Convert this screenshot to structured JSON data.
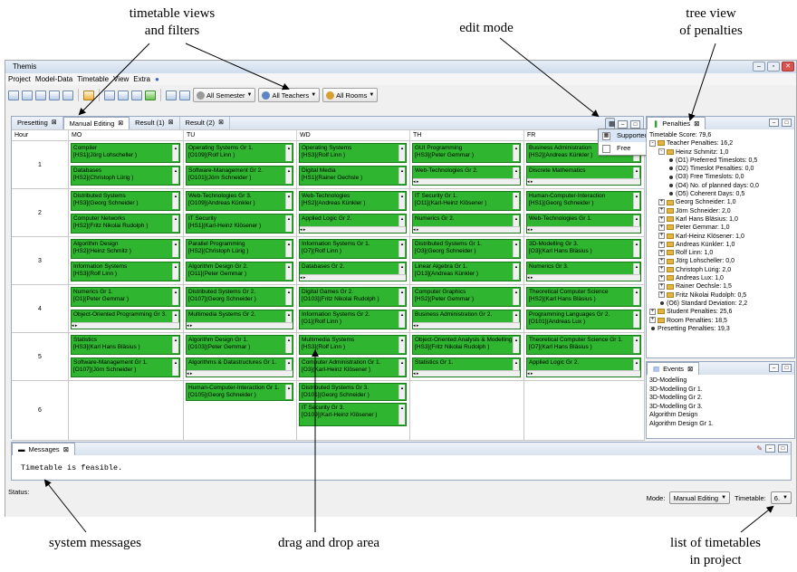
{
  "annotations": {
    "timetable_views": [
      "timetable views",
      "and filters"
    ],
    "edit_mode": "edit mode",
    "tree_view": [
      "tree view",
      "of penalties"
    ],
    "system_messages": "system messages",
    "drag_drop": "drag and drop area",
    "list_timetables": [
      "list of timetables",
      "in project"
    ]
  },
  "window": {
    "title": "Themis"
  },
  "menu": [
    "Project",
    "Model-Data",
    "Timetable",
    "View",
    "Extra"
  ],
  "filters": {
    "semester": "All Semester",
    "teachers": "All Teachers",
    "rooms": "All Rooms"
  },
  "editor_tabs": [
    {
      "label": "Presetting"
    },
    {
      "label": "Manual Editing"
    },
    {
      "label": "Result (1)"
    },
    {
      "label": "Result (2)"
    }
  ],
  "grid": {
    "hour_label": "Hour",
    "days": [
      "MO",
      "TU",
      "WD",
      "TH",
      "FR"
    ],
    "hours": [
      "1",
      "2",
      "3",
      "4",
      "5",
      "6"
    ]
  },
  "edit_mode_menu": {
    "options": [
      "Supported",
      "Free"
    ],
    "selected": "Supported"
  },
  "events": [
    [
      "Compiler",
      "[HS1](Jörg Lohscheller )",
      "Databases",
      "[HS2](Christoph Lürig )"
    ],
    [
      "Operating Systems Gr 1.",
      "[O109](Rolf Linn )",
      "Software-Management Gr 2.",
      "[O101](Jörn Schneider )"
    ],
    [
      "Operating Systems",
      "[HS3](Rolf Linn )",
      "Digital Media",
      "[HS1](Rainer Oechsle )"
    ],
    [
      "GUI Programming",
      "[HS3](Peter Gemmar )",
      "Web-Technologies Gr 2.",
      ""
    ],
    [
      "Business Administration",
      "[HS2](Andreas Künkler )",
      "Discrete Mathematics",
      ""
    ],
    [
      "Distributed Systems",
      "[HS3](Georg Schneider )",
      "Computer Networks",
      "[HS2](Fritz Nikolai Rudolph )"
    ],
    [
      "Web-Technologies Gr 3.",
      "[O109](Andreas Künkler )",
      "IT Security",
      "[HS1](Karl-Heinz Klösener )"
    ],
    [
      "Web-Technologies",
      "[HS2](Andreas Künkler )",
      "Applied Logic Gr 2.",
      ""
    ],
    [
      "IT Security Gr 1.",
      "[O11](Karl-Heinz Klösener )",
      "Numerics Gr 2.",
      ""
    ],
    [
      "Human-Computer-Interaction",
      "[HS1](Georg Schneider )",
      "Web-Technologies Gr 1.",
      ""
    ],
    [
      "Algorithm Design",
      "[HS2](Heinz Schmitz )",
      "Information Systems",
      "[HS3](Rolf Linn )"
    ],
    [
      "Parallel Programming",
      "[HS2](Christoph Lürig )",
      "Algorithm Design Gr 2.",
      "[O11](Peter Gemmar )"
    ],
    [
      "Information Systems Gr 1.",
      "[O7](Rolf Linn )",
      "Databases Gr 2.",
      ""
    ],
    [
      "Distributed Systems Gr 1.",
      "[O3](Georg Schneider )",
      "Linear Algebra Gr 1.",
      "[O13](Andreas Künkler )"
    ],
    [
      "3D-Modelling Gr 3.",
      "[O3](Karl Hans Bläsius )",
      "Numerics Gr 3.",
      ""
    ],
    [
      "Numerics Gr 1.",
      "[O1](Peter Gemmar )",
      "Object-Oriented Programming Gr 3.",
      ""
    ],
    [
      "Distributed Systems Gr 2.",
      "[O107](Georg Schneider )",
      "Multimedia Systems Gr 2.",
      ""
    ],
    [
      "Digital Games Gr 2.",
      "[O103](Fritz Nikolai Rudolph )",
      "Information Systems Gr 2.",
      "[O1](Rolf Linn )"
    ],
    [
      "Computer Graphics",
      "[HS2](Peter Gemmar )",
      "Business Administration Gr 2.",
      ""
    ],
    [
      "Theoretical Computer Science",
      "[HS2](Karl Hans Bläsius )",
      "Programming Languages Gr 2.",
      "[O101](Andreas Lux )"
    ],
    [
      "Statistics",
      "[HS3](Karl Hans Bläsius )",
      "Software-Management Gr 1.",
      "[O107](Jörn Schneider )"
    ],
    [
      "Algorithm Design Gr 1.",
      "[O103](Peter Gemmar )",
      "Algorithms & Datastructures Gr 1.",
      ""
    ],
    [
      "Multimedia Systems",
      "[HS3](Rolf Linn )",
      "Computer Administration Gr 1.",
      "[O3](Karl-Heinz Klösener )"
    ],
    [
      "Object-Oriented Analysis & Modelling",
      "[HS3](Fritz Nikolai Rudolph )",
      "Statistics Gr 1.",
      ""
    ],
    [
      "Theoretical Computer Science Gr 1.",
      "[O7](Karl Hans Bläsius )",
      "Applied Logic Gr 2.",
      ""
    ],
    [
      "",
      "",
      "",
      ""
    ],
    [
      "Human-Computer-Interaction Gr 1.",
      "[O105](Georg Schneider )",
      "",
      ""
    ],
    [
      "Distributed Systems Gr 3.",
      "[O101](Georg Schneider )",
      "IT Security Gr 3.",
      "[O109](Karl-Heinz Klösener )"
    ],
    [
      "",
      "",
      "",
      ""
    ],
    [
      "",
      "",
      "",
      ""
    ]
  ],
  "penalties": {
    "tab": "Penalties",
    "items": [
      {
        "t": "Timetable Score: 79,6",
        "lvl": 0,
        "k": "none"
      },
      {
        "t": "Teacher Penalties: 16,2",
        "lvl": 0,
        "k": "fold",
        "e": "-"
      },
      {
        "t": "Heinz Schmitz: 1,0",
        "lvl": 1,
        "k": "fold",
        "e": "-"
      },
      {
        "t": "(O1) Preferred Timeslots: 0,5",
        "lvl": 2,
        "k": "dot"
      },
      {
        "t": "(O2) Timeslot Penalties: 0,0",
        "lvl": 2,
        "k": "dot"
      },
      {
        "t": "(O3) Free Timeslots: 0,0",
        "lvl": 2,
        "k": "dot"
      },
      {
        "t": "(O4) No. of planned days: 0,0",
        "lvl": 2,
        "k": "dot"
      },
      {
        "t": "(O5) Coherent Days: 0,5",
        "lvl": 2,
        "k": "dot"
      },
      {
        "t": "Georg Schneider: 1,0",
        "lvl": 1,
        "k": "fold",
        "e": "+"
      },
      {
        "t": "Jörn Schneider: 2,0",
        "lvl": 1,
        "k": "fold",
        "e": "+"
      },
      {
        "t": "Karl Hans Bläsius: 1,0",
        "lvl": 1,
        "k": "fold",
        "e": "+"
      },
      {
        "t": "Peter Gemmar: 1,0",
        "lvl": 1,
        "k": "fold",
        "e": "+"
      },
      {
        "t": "Karl-Heinz Klösener: 1,0",
        "lvl": 1,
        "k": "fold",
        "e": "+"
      },
      {
        "t": "Andreas Künkler: 1,0",
        "lvl": 1,
        "k": "fold",
        "e": "+"
      },
      {
        "t": "Rolf Linn: 1,0",
        "lvl": 1,
        "k": "fold",
        "e": "+"
      },
      {
        "t": "Jörg Lohscheller: 0,0",
        "lvl": 1,
        "k": "fold",
        "e": "+"
      },
      {
        "t": "Christoph Lürig: 2,0",
        "lvl": 1,
        "k": "fold",
        "e": "+"
      },
      {
        "t": "Andreas Lux: 1,0",
        "lvl": 1,
        "k": "fold",
        "e": "+"
      },
      {
        "t": "Rainer Oechsle: 1,5",
        "lvl": 1,
        "k": "fold",
        "e": "+"
      },
      {
        "t": "Fritz Nikolai Rudolph: 0,5",
        "lvl": 1,
        "k": "fold",
        "e": "+"
      },
      {
        "t": "(O6) Standard Deviation: 2,2",
        "lvl": 1,
        "k": "dot"
      },
      {
        "t": "Student Penalties: 25,6",
        "lvl": 0,
        "k": "fold",
        "e": "+"
      },
      {
        "t": "Room Penalties: 18,5",
        "lvl": 0,
        "k": "fold",
        "e": "+"
      },
      {
        "t": "Presetting Penalties: 19,3",
        "lvl": 0,
        "k": "dot"
      }
    ]
  },
  "events_panel": {
    "tab": "Events",
    "items": [
      "3D-Modelling",
      "3D-Modelling Gr 1.",
      "3D-Modelling Gr 2.",
      "3D-Modelling Gr 3.",
      "Algorithm Design",
      "Algorithm Design Gr 1."
    ]
  },
  "messages": {
    "tab": "Messages",
    "text": "Timetable is feasible."
  },
  "status": {
    "label": "Status:",
    "mode_label": "Mode:",
    "mode_value": "Manual Editing",
    "timetable_label": "Timetable:",
    "timetable_value": "6."
  }
}
